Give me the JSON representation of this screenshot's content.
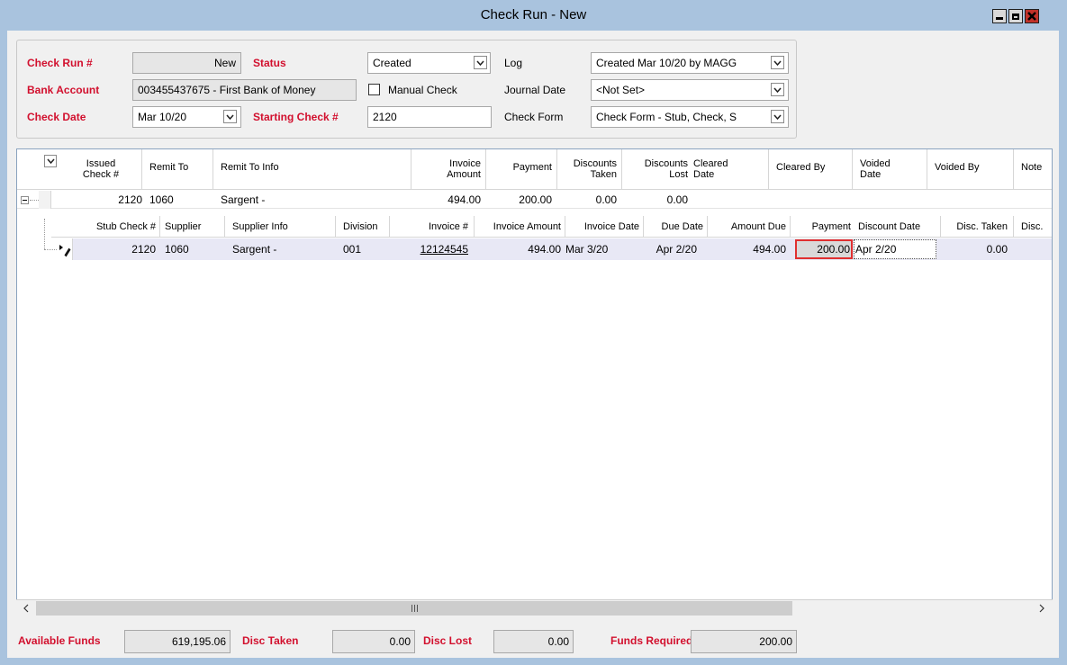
{
  "window": {
    "title": "Check Run - New"
  },
  "header": {
    "check_run_label": "Check Run #",
    "check_run_value": "New",
    "status_label": "Status",
    "status_value": "Created",
    "log_label": "Log",
    "log_value": "Created Mar 10/20 by MAGG",
    "bank_account_label": "Bank Account",
    "bank_account_value": "003455437675 - First Bank of Money",
    "manual_check_label": "Manual Check",
    "journal_date_label": "Journal Date",
    "journal_date_value": "<Not Set>",
    "check_date_label": "Check Date",
    "check_date_value": "Mar 10/20",
    "starting_check_label": "Starting Check #",
    "starting_check_value": "2120",
    "check_form_label": "Check Form",
    "check_form_value": "Check Form - Stub, Check, S"
  },
  "grid": {
    "columns": {
      "issued_check_1": "Issued",
      "issued_check_2": "Check #",
      "remit_to": "Remit To",
      "remit_to_info": "Remit To Info",
      "invoice_amount_1": "Invoice",
      "invoice_amount_2": "Amount",
      "payment": "Payment",
      "discounts_taken_1": "Discounts",
      "discounts_taken_2": "Taken",
      "discounts_lost_1": "Discounts",
      "discounts_lost_2": "Lost",
      "cleared_date_1": "Cleared",
      "cleared_date_2": "Date",
      "cleared_by": "Cleared By",
      "voided_date_1": "Voided",
      "voided_date_2": "Date",
      "voided_by": "Voided By",
      "note": "Note"
    },
    "row": {
      "issued_check": "2120",
      "remit_to": "1060",
      "remit_to_info": "Sargent -",
      "invoice_amount": "494.00",
      "payment": "200.00",
      "discounts_taken": "0.00",
      "discounts_lost": "0.00"
    },
    "sub_columns": {
      "stub_check": "Stub Check #",
      "supplier": "Supplier",
      "supplier_info": "Supplier Info",
      "division": "Division",
      "invoice_no": "Invoice #",
      "invoice_amount": "Invoice Amount",
      "invoice_date": "Invoice Date",
      "due_date": "Due Date",
      "amount_due": "Amount Due",
      "payment": "Payment",
      "discount_date": "Discount Date",
      "disc_taken": "Disc. Taken",
      "disc_more": "Disc."
    },
    "sub_row": {
      "stub_check": "2120",
      "supplier": "1060",
      "supplier_info": "Sargent -",
      "division": "001",
      "invoice_no": "12124545",
      "invoice_amount": "494.00",
      "invoice_date": "Mar 3/20",
      "due_date": "Apr 2/20",
      "amount_due": "494.00",
      "payment": "200.00",
      "discount_date": "Apr 2/20",
      "disc_taken": "0.00"
    }
  },
  "totals": {
    "available_funds_label": "Available Funds",
    "available_funds_value": "619,195.06",
    "disc_taken_label": "Disc Taken",
    "disc_taken_value": "0.00",
    "disc_lost_label": "Disc Lost",
    "disc_lost_value": "0.00",
    "funds_required_label": "Funds Required",
    "funds_required_value": "200.00"
  },
  "colors": {
    "label_red": "#d2102e",
    "highlight": "#e8e8f5",
    "title_bar": "#a9c3de",
    "outline_red": "#e03030"
  }
}
